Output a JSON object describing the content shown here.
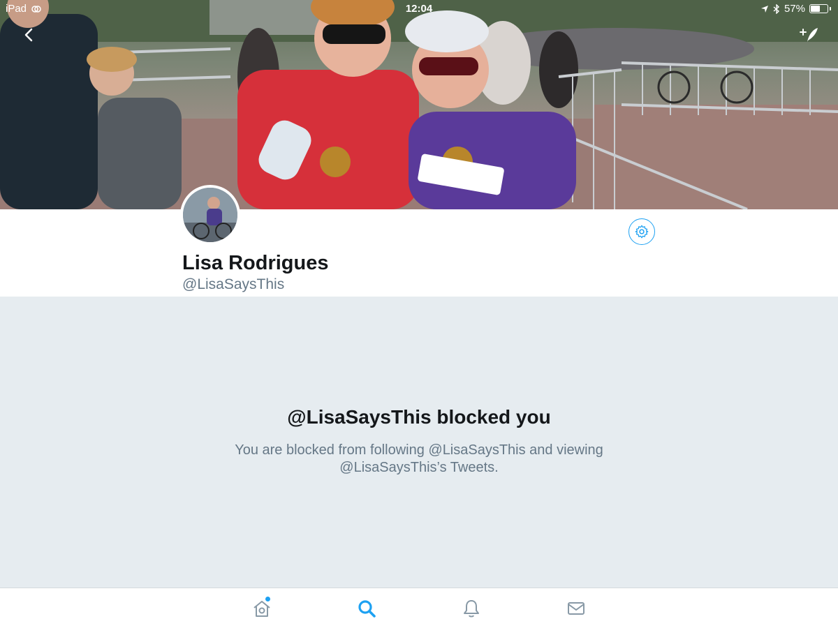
{
  "status_bar": {
    "device": "iPad",
    "time": "12:04",
    "battery_percent": "57%",
    "battery_level": 0.57
  },
  "header": {
    "back_icon": "chevron-left-icon",
    "compose_icon": "compose-tweet-icon"
  },
  "profile": {
    "display_name": "Lisa Rodrigues",
    "handle": "@LisaSaysThis",
    "settings_icon": "gear-icon"
  },
  "blocked": {
    "title": "@LisaSaysThis blocked you",
    "message": "You are blocked from following @LisaSaysThis and viewing @LisaSaysThis’s Tweets."
  },
  "tab_bar": {
    "items": [
      {
        "icon": "home-icon",
        "active": false,
        "has_notification_dot": true
      },
      {
        "icon": "search-icon",
        "active": true
      },
      {
        "icon": "bell-icon",
        "active": false
      },
      {
        "icon": "envelope-icon",
        "active": false
      }
    ]
  },
  "colors": {
    "accent": "#1da1f2",
    "text_primary": "#14171a",
    "text_secondary": "#657786",
    "background": "#e6ecf0"
  }
}
